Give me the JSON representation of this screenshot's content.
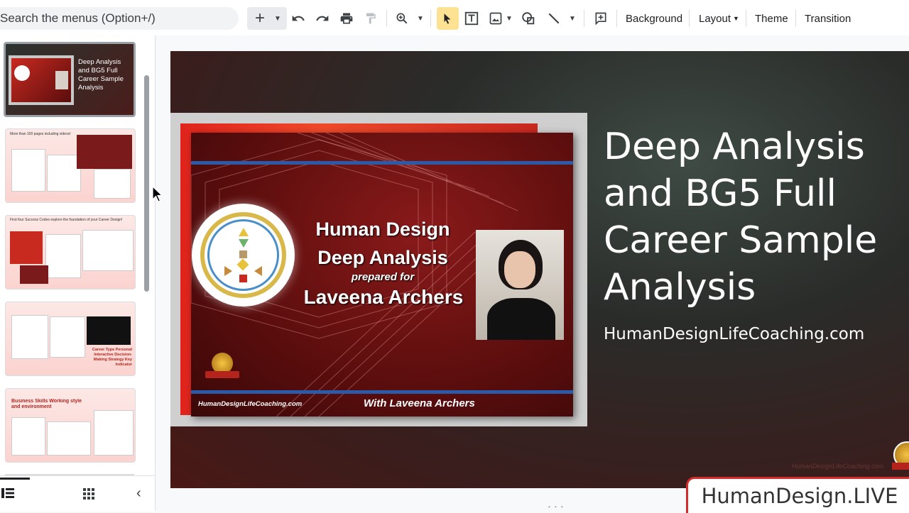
{
  "toolbar": {
    "search_placeholder": "Search the menus (Option+/)",
    "background_label": "Background",
    "layout_label": "Layout",
    "theme_label": "Theme",
    "transition_label": "Transition"
  },
  "slide": {
    "title_lines": [
      "Deep Analysis",
      "and BG5 Full",
      "Career Sample",
      "Analysis"
    ],
    "url": "HumanDesignLifeCoaching.com",
    "watermark": "HumanDesignLifeCoaching.com",
    "inner": {
      "line1": "Human Design",
      "line2": "Deep Analysis",
      "line3": "prepared for",
      "line4": "Laveena Archers",
      "footer_url": "HumanDesignLifeCoaching.com",
      "footer_with": "With Laveena Archers"
    }
  },
  "filmstrip": {
    "thumbs": [
      {
        "caption": "Deep Analysis and BG5 Full Career Sample Analysis"
      },
      {
        "caption": "More than 100 pages including videos!"
      },
      {
        "caption": "First four Success Codes explore the foundation of your Career Design!"
      },
      {
        "caption": "Career Type Personal Interactive Decision-Making Strategy Key Indicator"
      },
      {
        "caption": "Business Skills Working style and environment"
      }
    ]
  },
  "overlay": {
    "live_label": "HumanDesign.LIVE"
  },
  "colors": {
    "accent_red": "#d62b2b",
    "select_highlight": "#fde293",
    "slide_text": "#ffffff"
  }
}
